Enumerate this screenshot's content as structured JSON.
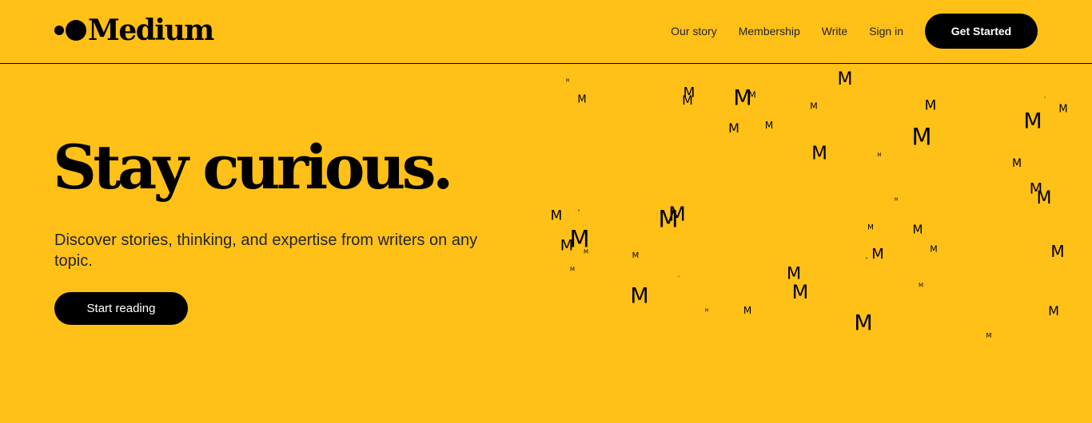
{
  "header": {
    "logo_text": "Medium",
    "nav": {
      "our_story": "Our story",
      "membership": "Membership",
      "write": "Write",
      "sign_in": "Sign in"
    },
    "get_started": "Get Started"
  },
  "hero": {
    "title": "Stay curious.",
    "subtitle": "Discover stories, thinking, and expertise from writers on any topic.",
    "cta": "Start reading"
  },
  "decoration": {
    "glyph": "M",
    "colors": {
      "background": "#FFC017",
      "ink": "#000000"
    }
  }
}
